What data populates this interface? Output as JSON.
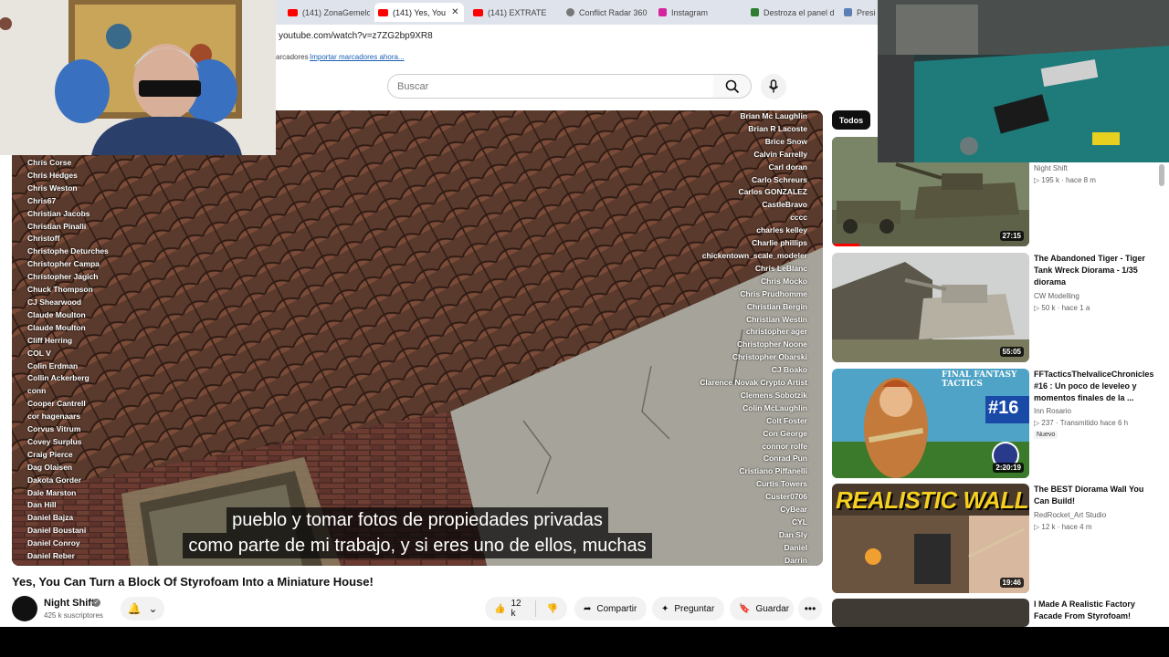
{
  "tabs": [
    {
      "label": "(141) ZonaGemelo",
      "active": false
    },
    {
      "label": "(141) Yes, You",
      "active": true
    },
    {
      "label": "(141) EXTRATE",
      "active": false
    },
    {
      "label": "Conflict Radar 360",
      "active": false
    },
    {
      "label": "Instagram",
      "active": false
    },
    {
      "label": "Destroza el panel d",
      "active": false
    },
    {
      "label": "Presi",
      "active": false
    }
  ],
  "address_bar": {
    "url": "youtube.com/watch?v=z7ZG2bp9XR8"
  },
  "bookmarks": {
    "text": "arcadores",
    "link": "Importar marcadores ahora..."
  },
  "search": {
    "placeholder": "Buscar"
  },
  "video": {
    "credits_left": [
      "Chris Corse",
      "Chris Hedges",
      "Chris Weston",
      "Chris67",
      "Christian Jacobs",
      "Christian Pinalli",
      "Christoff",
      "Christophe Deturches",
      "Christopher Campa",
      "Christopher Jagich",
      "Chuck Thompson",
      "CJ Shearwood",
      "Claude Moulton",
      "Claude Moulton",
      "Cliff Herring",
      "COL V",
      "Colin Erdman",
      "Collin Ackerberg",
      "conn",
      "Cooper Cantrell",
      "cor hagenaars",
      "Corvus Vitrum",
      "Covey Surplus",
      "Craig Pierce",
      "Dag Olaisen",
      "Dakota Gorder",
      "Dale Marston",
      "Dan Hill",
      "Daniel Bajza",
      "Daniel Boustani",
      "Daniel Conroy",
      "Daniel Reber"
    ],
    "credits_right": [
      "Brian Mc Laughlin",
      "Brian R Lacoste",
      "Brice Snow",
      "Calvin Farrelly",
      "Carl doran",
      "Carlo Schreurs",
      "Carlos GONZALEZ",
      "CastleBravo",
      "cccc",
      "charles kelley",
      "Charlie phillips",
      "chickentown_scale_modeler",
      "Chris LeBlanc",
      "Chris Mocko",
      "Chris Prudhomme",
      "Christian Bergin",
      "Christian Westin",
      "christopher ager",
      "Christopher Noone",
      "Christopher Obarski",
      "CJ Boako",
      "Clarence Novak   Crypto Artist",
      "Clemens Sobotzik",
      "Colin McLaughlin",
      "Colt Foster",
      "Con George",
      "connor rolfe",
      "Conrad Pun",
      "Cristiano Piffanelli",
      "Curtis Towers",
      "Custer0706",
      "CyBear",
      "CYL",
      "Dan Sly",
      "Daniel",
      "Darrin"
    ],
    "subtitles": [
      "pueblo y tomar fotos de propiedades privadas",
      "como parte de mi trabajo, y si eres uno de ellos, muchas"
    ]
  },
  "title": "Yes, You Can Turn a Block Of Styrofoam Into a Miniature House!",
  "channel": {
    "name": "Night Shift",
    "subscribers": "425 k suscriptores"
  },
  "actions": {
    "likes": "12 k",
    "share": "Compartir",
    "ask": "Preguntar",
    "save": "Guardar"
  },
  "sidebar": {
    "chip": "Todos",
    "items": [
      {
        "title": "",
        "channel": "Night Shift",
        "meta": "195 k · hace 8 m",
        "duration": "27:15",
        "badge": ""
      },
      {
        "title": "The Abandoned Tiger - Tiger Tank Wreck Diorama - 1/35 diorama",
        "channel": "CW Modelling",
        "meta": "50 k · hace 1 a",
        "duration": "55:05",
        "badge": ""
      },
      {
        "title": "FFTacticsTheIvaliceChronicles #16 : Un poco de leveleo y momentos finales de la ...",
        "channel": "Inn Rosario",
        "meta": "237 · Transmitido hace 6 h",
        "duration": "2:20:19",
        "badge": "Nuevo"
      },
      {
        "title": "The BEST Diorama Wall You Can Build!",
        "channel": "RedRocket_Art Studio",
        "meta": "12 k · hace 4 m",
        "duration": "19:46",
        "badge": ""
      },
      {
        "title": "I Made A Realistic Factory Facade From Styrofoam!",
        "channel": "",
        "meta": "",
        "duration": "",
        "badge": ""
      }
    ],
    "thumb_texts": {
      "realistic": "REALISTIC WALL",
      "fft": "FINAL FANTASY TACTICS",
      "fft_num": "#16"
    }
  },
  "colors": {
    "youtube_red": "#ff0000",
    "text": "#0f0f0f",
    "muted": "#606060",
    "chip_bg": "#f2f2f2"
  }
}
